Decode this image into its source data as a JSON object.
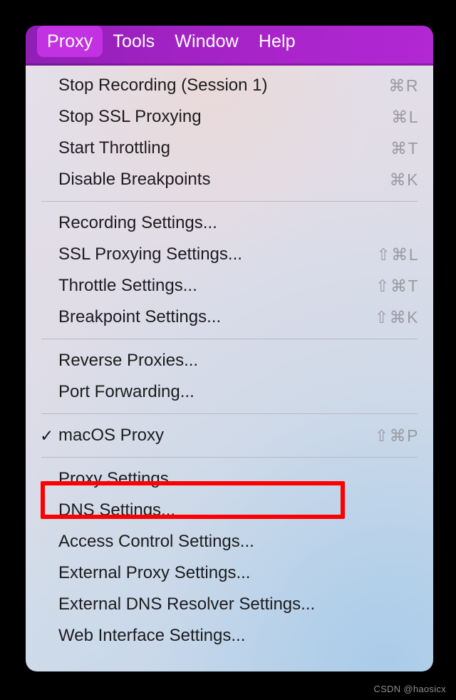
{
  "menubar": {
    "items": [
      {
        "label": "Proxy",
        "active": true
      },
      {
        "label": "Tools",
        "active": false
      },
      {
        "label": "Window",
        "active": false
      },
      {
        "label": "Help",
        "active": false
      }
    ]
  },
  "menu": {
    "title": "Proxy",
    "groups": [
      {
        "items": [
          {
            "label": "Stop Recording (Session 1)",
            "shortcut": "⌘R",
            "checked": false
          },
          {
            "label": "Stop SSL Proxying",
            "shortcut": "⌘L",
            "checked": false
          },
          {
            "label": "Start Throttling",
            "shortcut": "⌘T",
            "checked": false
          },
          {
            "label": "Disable Breakpoints",
            "shortcut": "⌘K",
            "checked": false
          }
        ]
      },
      {
        "items": [
          {
            "label": "Recording Settings...",
            "shortcut": "",
            "checked": false
          },
          {
            "label": "SSL Proxying Settings...",
            "shortcut": "⇧⌘L",
            "checked": false
          },
          {
            "label": "Throttle Settings...",
            "shortcut": "⇧⌘T",
            "checked": false
          },
          {
            "label": "Breakpoint Settings...",
            "shortcut": "⇧⌘K",
            "checked": false
          }
        ]
      },
      {
        "items": [
          {
            "label": "Reverse Proxies...",
            "shortcut": "",
            "checked": false
          },
          {
            "label": "Port Forwarding...",
            "shortcut": "",
            "checked": false
          }
        ]
      },
      {
        "items": [
          {
            "label": "macOS Proxy",
            "shortcut": "⇧⌘P",
            "checked": true
          }
        ]
      },
      {
        "items": [
          {
            "label": "Proxy Settings...",
            "shortcut": "",
            "checked": false,
            "highlighted": true
          },
          {
            "label": "DNS Settings...",
            "shortcut": "",
            "checked": false
          },
          {
            "label": "Access Control Settings...",
            "shortcut": "",
            "checked": false
          },
          {
            "label": "External Proxy Settings...",
            "shortcut": "",
            "checked": false
          },
          {
            "label": "External DNS Resolver Settings...",
            "shortcut": "",
            "checked": false
          },
          {
            "label": "Web Interface Settings...",
            "shortcut": "",
            "checked": false
          }
        ]
      }
    ]
  },
  "annotation": {
    "target_label": "Proxy Settings...",
    "color": "#fd0000"
  },
  "watermark": {
    "text": "CSDN @haosicx"
  },
  "colors": {
    "menubar_purple": "#a222c4",
    "menubar_active": "#c231e2",
    "panel_top": "#e4dfe8",
    "panel_bottom": "#c4d6e9",
    "text": "#1c1c1e",
    "shortcut_text": "#9a9aa0",
    "separator": "#b9b8bf",
    "highlight_red": "#fd0000"
  },
  "glyphs": {
    "command": "⌘",
    "shift": "⇧",
    "checkmark": "✓"
  }
}
